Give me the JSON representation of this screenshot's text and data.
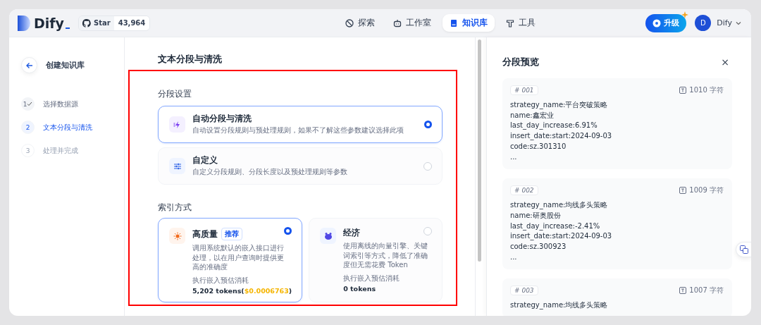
{
  "header": {
    "logo": "Dify",
    "github": {
      "label": "Star",
      "count": "43,964"
    },
    "nav": [
      {
        "label": "探索",
        "selected": false
      },
      {
        "label": "工作室",
        "selected": false
      },
      {
        "label": "知识库",
        "selected": true
      },
      {
        "label": "工具",
        "selected": false
      }
    ],
    "upgrade": "升级",
    "user": {
      "avatar": "D",
      "name": "Dify"
    }
  },
  "sidebar": {
    "title": "创建知识库",
    "steps": [
      {
        "number": "1",
        "label": "选择数据源",
        "kind": "done"
      },
      {
        "number": "2",
        "label": "文本分段与清洗",
        "kind": "current"
      },
      {
        "number": "3",
        "label": "处理并完成",
        "kind": "pending"
      }
    ]
  },
  "main": {
    "title": "文本分段与清洗",
    "segmentation": {
      "label": "分段设置",
      "options": [
        {
          "title": "自动分段与清洗",
          "description": "自动设置分段规则与预处理规则，如果不了解这些参数建议选择此项",
          "selected": true
        },
        {
          "title": "自定义",
          "description": "自定义分段规则、分段长度以及预处理规则等参数",
          "selected": false
        }
      ]
    },
    "indexing": {
      "label": "索引方式",
      "options": [
        {
          "title": "高质量",
          "badge": "推荐",
          "description": "调用系统默认的嵌入接口进行处理，以在用户查询时提供更高的准确度",
          "cost_label": "执行嵌入预估消耗",
          "cost": "5,202 tokens(",
          "price": "$0.0006763",
          "cost_end": ")",
          "selected": true
        },
        {
          "title": "经济",
          "description": "使用离线的向量引擎、关键词索引等方式，降低了准确度但无需花费 Token",
          "cost_label": "执行嵌入预估消耗",
          "cost": "0 tokens",
          "selected": false
        }
      ]
    }
  },
  "preview": {
    "title": "分段预览",
    "close": "×",
    "chunks": [
      {
        "index": "# 001",
        "chars": "1010 字符",
        "lines": [
          "strategy_name:平台突破策略",
          "name:鑫宏业",
          "last_day_increase:6.91%",
          "insert_date:start:2024-09-03",
          "code:sz.301310",
          "..."
        ]
      },
      {
        "index": "# 002",
        "chars": "1009 字符",
        "lines": [
          "strategy_name:均线多头策略",
          "name:研奥股份",
          "last_day_increase:-2.41%",
          "insert_date:start:2024-09-03",
          "code:sz.300923",
          "..."
        ]
      },
      {
        "index": "# 003",
        "chars": "1007 字符",
        "lines": [
          "strategy_name:均线多头策略"
        ]
      }
    ]
  }
}
